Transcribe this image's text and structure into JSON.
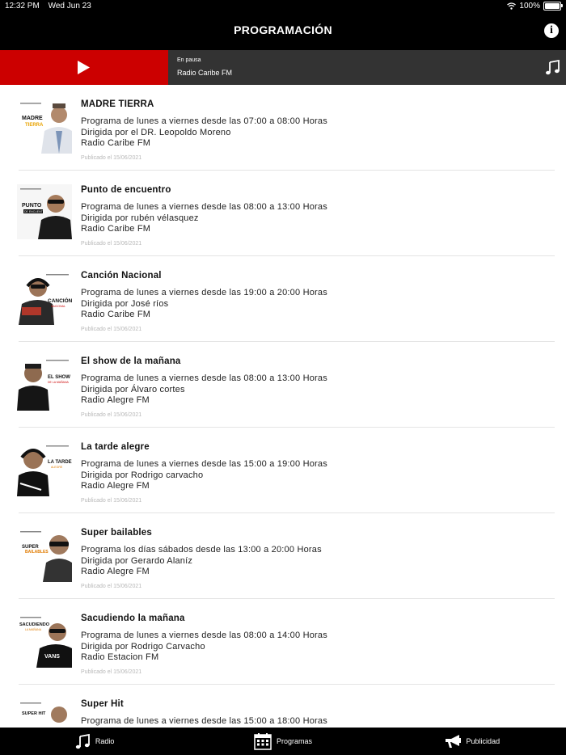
{
  "status": {
    "time": "12:32 PM",
    "date": "Wed Jun 23",
    "battery": "100%"
  },
  "header": {
    "title": "PROGRAMACIÓN",
    "info_icon": "info-icon"
  },
  "player": {
    "status": "En pausa",
    "station": "Radio Caribe FM",
    "accent": "#cc0000"
  },
  "programs": [
    {
      "title": "MADRE TIERRA",
      "schedule": "Programa de lunes a viernes desde las 07:00 a 08:00 Horas",
      "host": "Dirigida por el DR. Leopoldo Moreno",
      "station": "Radio Caribe FM",
      "published": "Publicado el 15/06/2021",
      "thumb_text": [
        "MADRE",
        "TIERRA"
      ]
    },
    {
      "title": "Punto de encuentro",
      "schedule": "Programa de lunes a viernes desde las 08:00 a 13:00 Horas",
      "host": "Dirigida por rubén vélasquez",
      "station": "Radio Caribe FM",
      "published": "Publicado el 15/06/2021",
      "thumb_text": [
        "PUNTO",
        "DE ENCUENTRO"
      ]
    },
    {
      "title": "Canción Nacional",
      "schedule": "Programa de lunes a viernes desde las 19:00 a 20:00 Horas",
      "host": "Dirigida por José ríos",
      "station": "Radio Caribe FM",
      "published": "Publicado el 15/06/2021",
      "thumb_text": [
        "CANCIÓN",
        "NACIONAL"
      ]
    },
    {
      "title": "El show de la mañana",
      "schedule": "Programa de lunes a viernes desde las 08:00 a 13:00 Horas",
      "host": "Dirigida por Álvaro cortes",
      "station": "Radio Alegre FM",
      "published": "Publicado el 15/06/2021",
      "thumb_text": [
        "EL SHOW",
        "DE LA MAÑANA"
      ]
    },
    {
      "title": "La tarde alegre",
      "schedule": "Programa de lunes a viernes desde las 15:00 a 19:00 Horas",
      "host": "Dirigida por Rodrigo carvacho",
      "station": "Radio Alegre FM",
      "published": "Publicado el 15/06/2021",
      "thumb_text": [
        "LA TARDE",
        "ALEGRE"
      ]
    },
    {
      "title": "Super bailables",
      "schedule": "Programa los días sábados desde las 13:00 a 20:00 Horas",
      "host": "Dirigida por Gerardo Alaníz",
      "station": "Radio Alegre FM",
      "published": "Publicado el 15/06/2021",
      "thumb_text": [
        "SUPER",
        "BAILABLES"
      ]
    },
    {
      "title": "Sacudiendo la mañana",
      "schedule": "Programa de lunes a viernes desde las 08:00 a 14:00 Horas",
      "host": "Dirigida por Rodrigo Carvacho",
      "station": "Radio Estacion FM",
      "published": "Publicado el 15/06/2021",
      "thumb_text": [
        "SACUDIENDO",
        "LA MAÑANA"
      ]
    },
    {
      "title": "Super Hit",
      "schedule": "Programa de lunes a viernes desde las 15:00 a 18:00 Horas",
      "host": "",
      "station": "",
      "published": "",
      "thumb_text": [
        "SUPER HIT",
        ""
      ]
    }
  ],
  "tabs": [
    {
      "label": "Radio",
      "icon": "music-note-icon"
    },
    {
      "label": "Programas",
      "icon": "calendar-icon"
    },
    {
      "label": "Publicidad",
      "icon": "megaphone-icon"
    }
  ]
}
